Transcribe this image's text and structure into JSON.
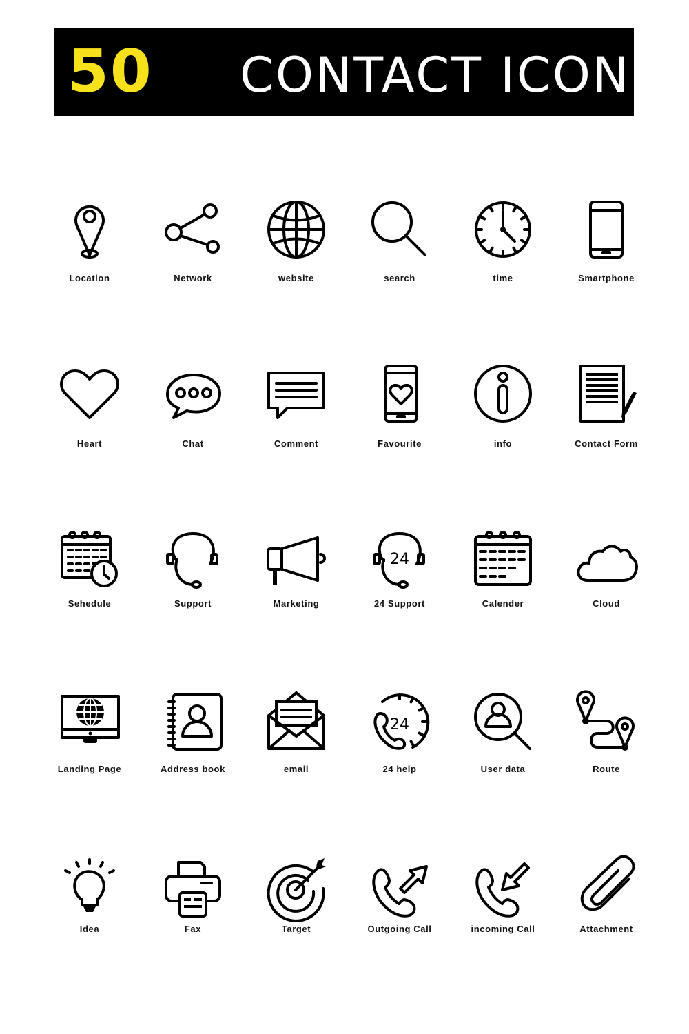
{
  "header": {
    "count": "50",
    "title": "CONTACT ICON",
    "accent_color": "#f7e11b",
    "background_color": "#000000"
  },
  "icons": [
    {
      "label": "Location",
      "icon": "location-icon"
    },
    {
      "label": "Network",
      "icon": "network-icon"
    },
    {
      "label": "website",
      "icon": "website-icon"
    },
    {
      "label": "search",
      "icon": "search-icon"
    },
    {
      "label": "time",
      "icon": "time-icon"
    },
    {
      "label": "Smartphone",
      "icon": "smartphone-icon"
    },
    {
      "label": "Heart",
      "icon": "heart-icon"
    },
    {
      "label": "Chat",
      "icon": "chat-icon"
    },
    {
      "label": "Comment",
      "icon": "comment-icon"
    },
    {
      "label": "Favourite",
      "icon": "favourite-icon"
    },
    {
      "label": "info",
      "icon": "info-icon"
    },
    {
      "label": "Contact Form",
      "icon": "contact-form-icon"
    },
    {
      "label": "Sehedule",
      "icon": "schedule-icon"
    },
    {
      "label": "Support",
      "icon": "support-icon"
    },
    {
      "label": "Marketing",
      "icon": "marketing-icon"
    },
    {
      "label": "24 Support",
      "icon": "support-24-icon",
      "text": "24"
    },
    {
      "label": "Calender",
      "icon": "calendar-icon"
    },
    {
      "label": "Cloud",
      "icon": "cloud-icon"
    },
    {
      "label": "Landing Page",
      "icon": "landing-page-icon"
    },
    {
      "label": "Address book",
      "icon": "address-book-icon"
    },
    {
      "label": "email",
      "icon": "email-icon"
    },
    {
      "label": "24 help",
      "icon": "help-24-icon",
      "text": "24"
    },
    {
      "label": "User data",
      "icon": "user-data-icon"
    },
    {
      "label": "Route",
      "icon": "route-icon"
    },
    {
      "label": "Idea",
      "icon": "idea-icon"
    },
    {
      "label": "Fax",
      "icon": "fax-icon"
    },
    {
      "label": "Target",
      "icon": "target-icon"
    },
    {
      "label": "Outgoing Call",
      "icon": "outgoing-call-icon"
    },
    {
      "label": "incoming Call",
      "icon": "incoming-call-icon"
    },
    {
      "label": "Attachment",
      "icon": "attachment-icon"
    }
  ]
}
